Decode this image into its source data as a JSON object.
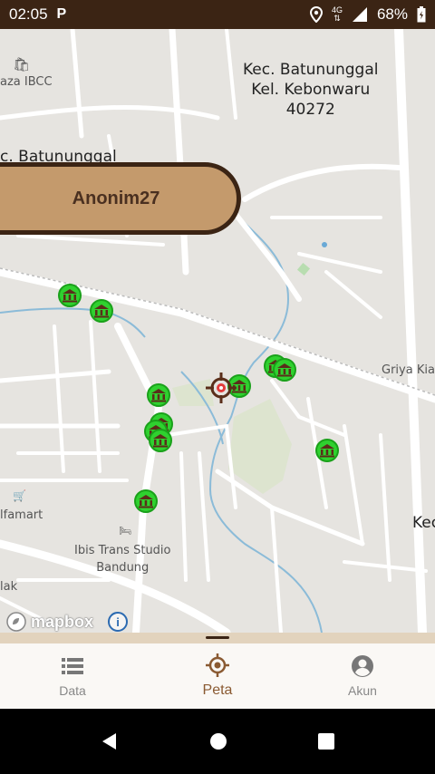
{
  "status_bar": {
    "time": "02:05",
    "app_icon": "P",
    "network_type": "4G",
    "battery_percent": "68%"
  },
  "map": {
    "labels": {
      "district_main": [
        "Kec. Batununggal",
        "Kel. Kebonwaru",
        "40272"
      ],
      "plaza": "aza IBCC",
      "district_left": "c. Batununggal",
      "griya": "Griya Kia",
      "kec_right": "Kec",
      "alfamart": "lfamart",
      "ibis": [
        "Ibis Trans Studio",
        "Bandung"
      ],
      "jalan": "lak"
    },
    "user_name": "Anonim27",
    "attribution": "mapbox",
    "info": "i",
    "marker_icon": "museum-icon",
    "colors": {
      "marker_fill": "#2fd12f",
      "pill_bg": "#c49a6c",
      "pill_border": "#3b2414",
      "accent": "#8a5a32"
    }
  },
  "bottom_nav": {
    "items": [
      {
        "label": "Data",
        "icon": "list-icon",
        "active": false
      },
      {
        "label": "Peta",
        "icon": "target-icon",
        "active": true
      },
      {
        "label": "Akun",
        "icon": "account-icon",
        "active": false
      }
    ]
  }
}
